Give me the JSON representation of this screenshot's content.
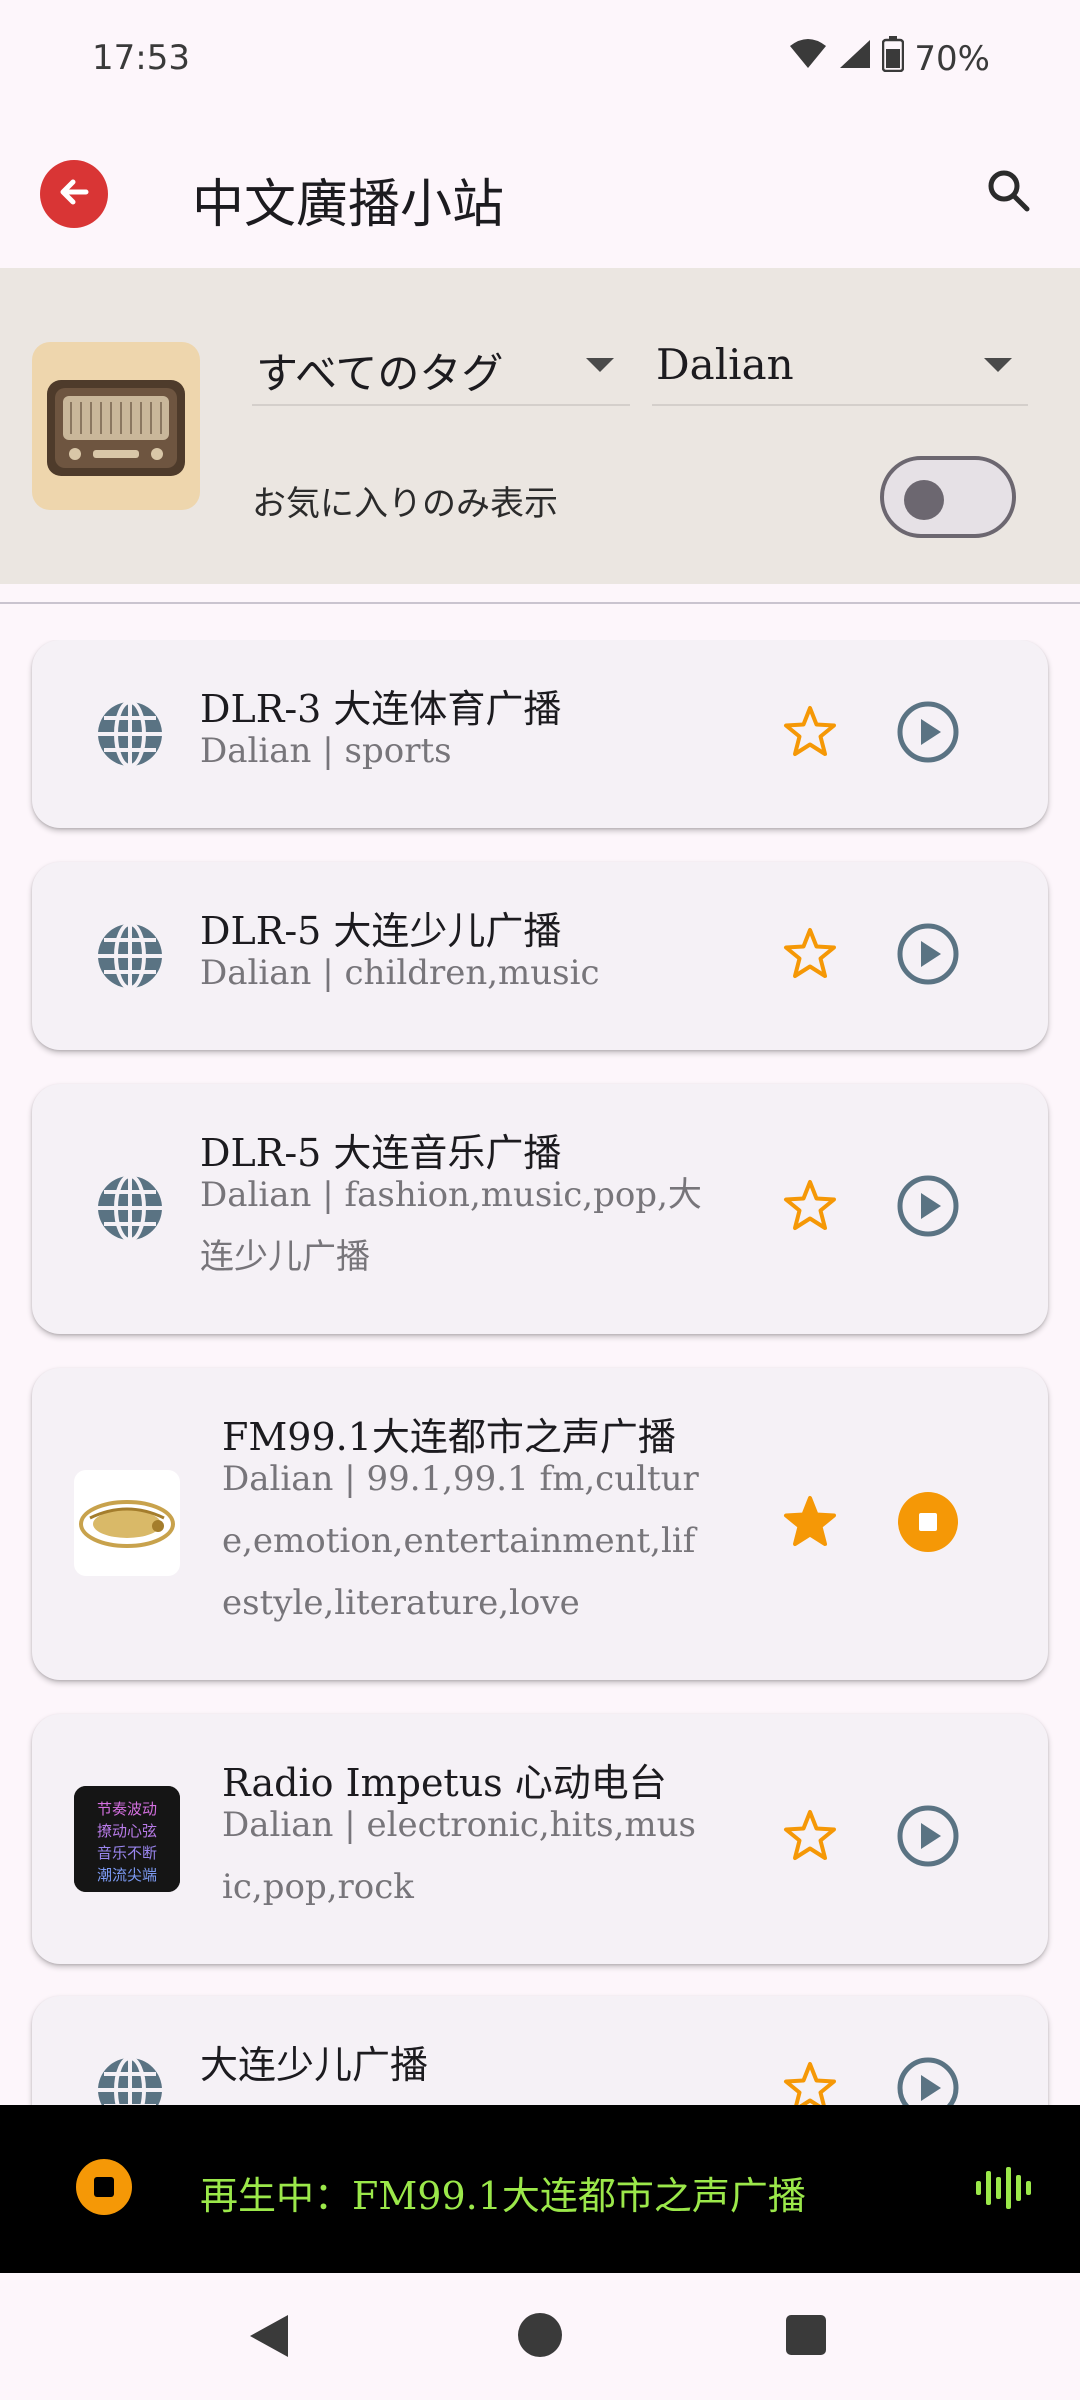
{
  "status_bar": {
    "time": "17:53",
    "battery": "70%",
    "icons": [
      "wifi-icon",
      "signal-icon",
      "battery-icon"
    ]
  },
  "app_bar": {
    "title": "中文廣播小站",
    "back_icon": "arrow-left-icon",
    "search_icon": "search-icon"
  },
  "filters": {
    "tag_dropdown": "すべてのタグ",
    "city_dropdown": "Dalian",
    "favorites_only_label": "お気に入りのみ表示",
    "favorites_only_on": false
  },
  "stations": [
    {
      "title": "DLR-3 大连体育广播",
      "subtitle": "Dalian | sports",
      "icon": "globe-icon",
      "favorite": false,
      "playing": false
    },
    {
      "title": "DLR-5 大连少儿广播",
      "subtitle": "Dalian | children,music",
      "icon": "globe-icon",
      "favorite": false,
      "playing": false
    },
    {
      "title": "DLR-5 大连音乐广播",
      "subtitle": "Dalian | fashion,music,pop,大连少儿广播",
      "icon": "globe-icon",
      "favorite": false,
      "playing": false
    },
    {
      "title": "FM99.1大连都市之声广播",
      "subtitle": "Dalian | 99.1,99.1 fm,culture,emotion,entertainment,lifestyle,literature,love",
      "icon": "station-logo-fm991",
      "favorite": true,
      "playing": true
    },
    {
      "title": "Radio Impetus 心动电台",
      "subtitle": "Dalian | electronic,hits,music,pop,rock",
      "icon": "station-logo-impetus",
      "favorite": false,
      "playing": false
    },
    {
      "title": "大连少儿广播",
      "subtitle": "",
      "icon": "globe-icon",
      "favorite": false,
      "playing": false
    }
  ],
  "logos": {
    "impetus_text": "节奏波动 撩动心弦 音乐不断 潮流尖端"
  },
  "now_playing": {
    "text": "再生中：FM99.1大连都市之声广播"
  },
  "colors": {
    "accent_red": "#d93535",
    "star_orange": "#f59806",
    "play_gray": "#5a7383",
    "now_playing_green": "#9be84a"
  }
}
